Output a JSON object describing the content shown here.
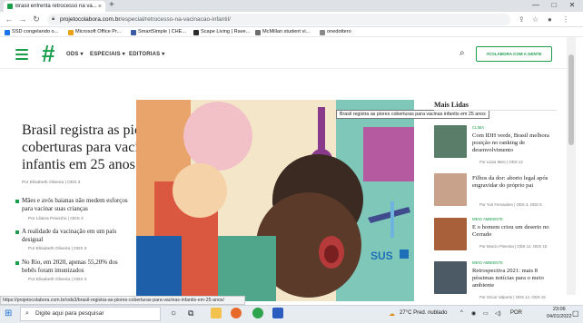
{
  "browser": {
    "tab_title": "Brasil enfrenta retrocesso na va...",
    "tab_close": "×",
    "new_tab": "+",
    "window_controls": [
      "—",
      "□",
      "✕"
    ],
    "url_domain": "projetocolabora.com.br",
    "url_path": "/especial/retrocesso-na-vacinacao-infantil/",
    "bookmarks": [
      {
        "label": "SSD congelando o...",
        "color": "#1a73e8"
      },
      {
        "label": "Microsoft Office Pr...",
        "color": "#e8a317"
      },
      {
        "label": "SmartSimple | CHE...",
        "color": "#3b5ba5"
      },
      {
        "label": "Scape Living | Rave...",
        "color": "#2b2b2b"
      },
      {
        "label": "McMillan student vi...",
        "color": "#6d6d6d"
      },
      {
        "label": "onedottero",
        "color": "#888888"
      }
    ],
    "status_url": "https://projetocolabora.com.br/ods3/brasil-registra-as-piores-coberturas-para-vacinas-infantis-em-25-anos/"
  },
  "site": {
    "logo": "#",
    "menu": [
      "ODS",
      "ESPECIAIS",
      "EDITORIAS"
    ],
    "cta_label": "#COLABORA COM A GENTE",
    "accent": "#1b9e4b"
  },
  "main": {
    "headline": "Brasil registra as piores coberturas para vacinas infantis em 25 anos",
    "byline": "Por Elisabeth Oliveira | ODS 3",
    "bullets": [
      {
        "text": "Mães e avós baianas não medem esforços para vacinar suas crianças",
        "byline": "Por Liliana Peixinho | ODS 3"
      },
      {
        "text": "A realidade da vacinação em um país desigual",
        "byline": "Por Elisabeth Oliveira | ODS 3"
      },
      {
        "text": "No Rio, em 2020, apenas 55,20% dos bebês foram imunizados",
        "byline": "Por Elisabeth Oliveira | ODS 3"
      }
    ],
    "tooltip": "Brasil registra as piores coberturas para vacinas infantis em 25 anos",
    "hero_badge": "SUS"
  },
  "sidebar": {
    "title": "Mais Lidas",
    "items": [
      {
        "category": "CLIMA",
        "title": "Com IDH verde, Brasil melhora posição no ranking de desenvolvimento",
        "byline": "Por Liana Melo | ODS 13",
        "thumb": "#5a7d6a"
      },
      {
        "category": "",
        "title": "Filhos da dor: aborto legal após engravidar do próprio pai",
        "byline": "Por Yuri Fernandes | ODS 3, ODS 5",
        "thumb": "#c9a28c"
      },
      {
        "category": "MEIO AMBIENTE",
        "title": "E o homem criou um deserto no Cerrado",
        "byline": "Por Marcio Pimenta | ODS 12, ODS 15",
        "thumb": "#a8603a"
      },
      {
        "category": "MEIO AMBIENTE",
        "title": "Retrospectiva 2021: mais 8 péssimas notícias para o meio ambiente",
        "byline": "Por Oscar Valporto | ODS 14, ODS 15",
        "thumb": "#4c5a66"
      }
    ]
  },
  "taskbar": {
    "search_placeholder": "Digite aqui para pesquisar",
    "weather": "27°C  Pred. nublado",
    "lang": "POR",
    "time": "23:06",
    "date": "04/01/2022"
  }
}
